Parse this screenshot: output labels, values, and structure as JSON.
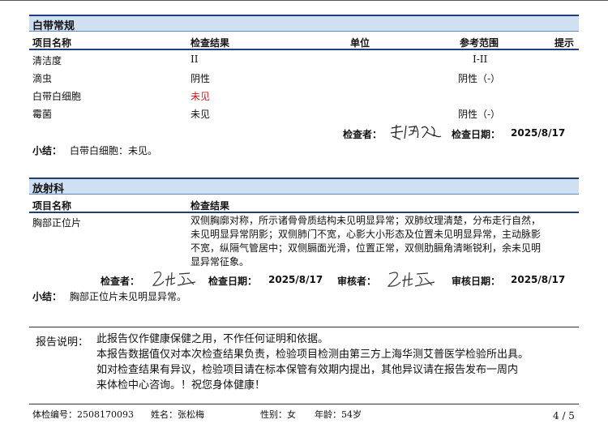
{
  "leucorrhea": {
    "title": "白带常规",
    "columns": {
      "name": "项目名称",
      "result": "检查结果",
      "unit": "单位",
      "range": "参考范围",
      "hint": "提示"
    },
    "rows": [
      {
        "name": "清洁度",
        "result": "II",
        "range": "I-II"
      },
      {
        "name": "滴虫",
        "result": "阴性",
        "range": "阴性（-）"
      },
      {
        "name": "白带白细胞",
        "result": "未见",
        "range": ""
      },
      {
        "name": "霉菌",
        "result": "未见",
        "range": "阴性（-）"
      }
    ],
    "inspector_label": "检查者：",
    "date_label": "检查日期：",
    "date": "2025/8/17",
    "summary_label": "小结：",
    "summary": "白带白细胞：未见。"
  },
  "radiology": {
    "title": "放射科",
    "columns": {
      "name": "项目名称",
      "result": "检查结果"
    },
    "row": {
      "name": "胸部正位片",
      "result_lines": [
        "双侧胸廓对称，所示诸骨骨质结构未见明显异常；双肺纹理清楚，分布走行自然，",
        "未见明显异常阴影；双侧肺门不宽，心影大小形态及位置未见明显异常，主动脉影",
        "不宽，纵隔气管居中；双侧膈面光滑，位置正常，双侧肋膈角清晰锐利，余未见明",
        "显异常征象。"
      ]
    },
    "inspector_label": "检查者：",
    "date_label": "检查日期：",
    "date": "2025/8/17",
    "reviewer_label": "审核者：",
    "review_date_label": "审核日期：",
    "review_date": "2025/8/17",
    "summary_label": "小结：",
    "summary": "胸部正位片未见明显异常。"
  },
  "notes": {
    "label": "报告说明：",
    "lines": [
      "此报告仅作健康保健之用，不作任何证明和依据。",
      "本报告数据值仅对本次检查结果负责，检验项目检测由第三方上海华测艾普医学检验所出具。",
      "如对检查结果有异议，检验项目请在标本保管有效期内提出，其他异议请在报告发布一周内",
      "来体检中心咨询。！祝您身体健康！"
    ]
  },
  "footer": {
    "exam_no": "体检编号：2508170093",
    "name": "姓名：张松梅",
    "gender": "性别：女",
    "age": "年龄：54岁",
    "page": "4 / 5"
  }
}
